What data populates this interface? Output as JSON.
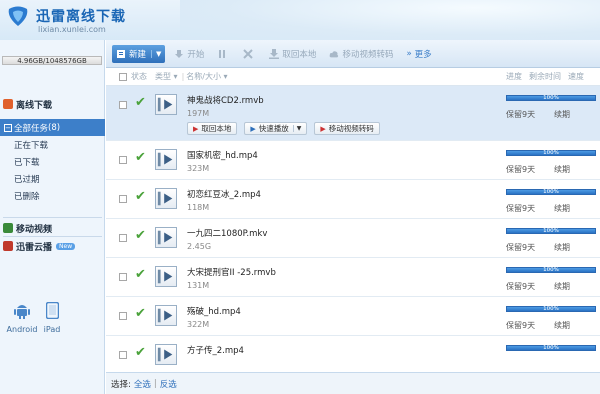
{
  "brand": {
    "title": "迅雷离线下载",
    "url": "lixian.xunlei.com"
  },
  "sidebar": {
    "quota": "4.96GB/1048576GB",
    "offline_header": "离线下载",
    "items": [
      {
        "label": "全部任务",
        "count": "(8)"
      },
      {
        "label": "正在下载"
      },
      {
        "label": "已下载"
      },
      {
        "label": "已过期"
      },
      {
        "label": "已删除"
      }
    ],
    "mobile_video": "移动视频",
    "cloud": "迅雷云播",
    "cloud_badge": "New",
    "devices": [
      "Android",
      "iPad"
    ]
  },
  "toolbar": {
    "new_label": "新建",
    "start_label": "开始",
    "fetch_local_label": "取回本地",
    "mobile_convert_label": "移动视频转码",
    "more_label": "更多"
  },
  "columns": {
    "status": "状态",
    "type": "类型",
    "name_size": "名称/大小",
    "progress": "进度",
    "remaining": "剩余时间",
    "speed": "速度"
  },
  "row_actions": {
    "fetch_local": "取回本地",
    "quick_play": "快速播放",
    "mobile_convert": "移动视频转码"
  },
  "tasks": [
    {
      "name": "神鬼战将CD2.rmvb",
      "size": "197M",
      "progress_text": "100%",
      "progress": 1.0,
      "keep": "保留9天",
      "renew": "续期"
    },
    {
      "name": "国家机密_hd.mp4",
      "size": "323M",
      "progress_text": "100%",
      "progress": 1.0,
      "keep": "保留9天",
      "renew": "续期"
    },
    {
      "name": "初恋红豆冰_2.mp4",
      "size": "118M",
      "progress_text": "100%",
      "progress": 1.0,
      "keep": "保留9天",
      "renew": "续期"
    },
    {
      "name": "一九四二1080P.mkv",
      "size": "2.45G",
      "progress_text": "100%",
      "progress": 1.0,
      "keep": "保留9天",
      "renew": "续期"
    },
    {
      "name": "大宋提刑官II -25.rmvb",
      "size": "131M",
      "progress_text": "100%",
      "progress": 1.0,
      "keep": "保留9天",
      "renew": "续期"
    },
    {
      "name": "殇破_hd.mp4",
      "size": "322M",
      "progress_text": "100%",
      "progress": 1.0,
      "keep": "保留9天",
      "renew": "续期"
    },
    {
      "name": "方子传_2.mp4",
      "size": "",
      "progress_text": "100%",
      "progress": 1.0,
      "keep": "",
      "renew": ""
    }
  ],
  "footer": {
    "select_label": "选择:",
    "select_all": "全选",
    "invert": "反选"
  }
}
